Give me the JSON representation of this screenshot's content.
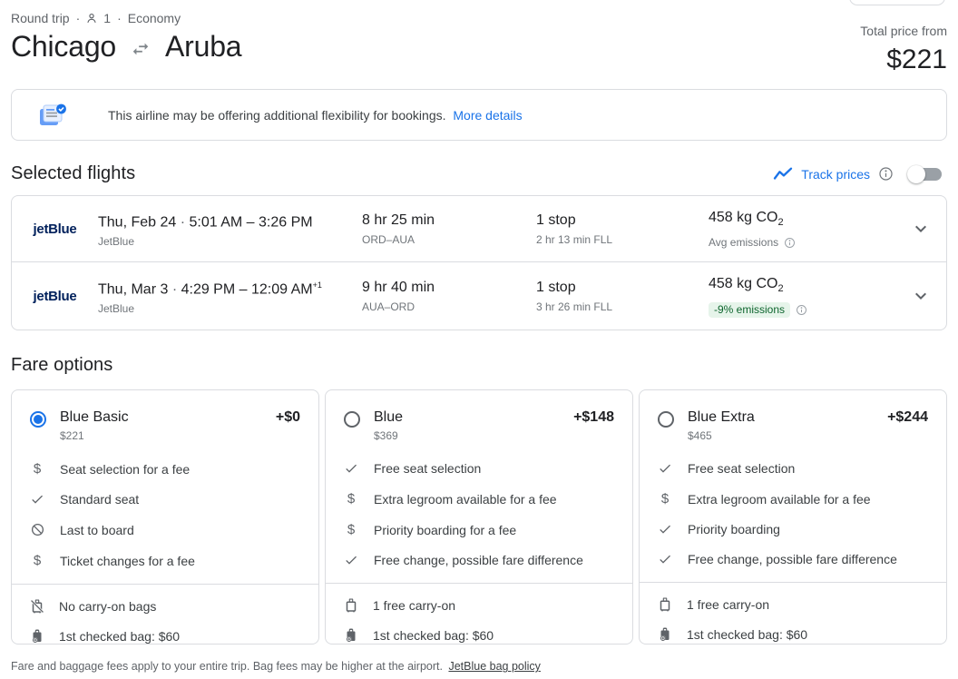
{
  "header": {
    "trip_type": "Round trip",
    "separator": "·",
    "passenger_count": "1",
    "cabin_class": "Economy",
    "origin": "Chicago",
    "destination": "Aruba",
    "total_price_label": "Total price from",
    "total_price": "$221"
  },
  "banner": {
    "message": "This airline may be offering additional flexibility for bookings.",
    "link_label": "More details"
  },
  "selected_flights": {
    "title": "Selected flights",
    "track_prices": {
      "label": "Track prices",
      "enabled": false
    },
    "flights": [
      {
        "airline_logo_text": "jetBlue",
        "date": "Thu, Feb 24",
        "dot": "·",
        "times": "5:01 AM – 3:26 PM",
        "times_superscript": "",
        "airline": "JetBlue",
        "duration": "8 hr 25 min",
        "route": "ORD–AUA",
        "stops": "1 stop",
        "stops_detail": "2 hr 13 min FLL",
        "emissions_prefix": "458 kg CO",
        "emissions_sub": "2",
        "emissions_note": "Avg emissions",
        "emissions_badge": false
      },
      {
        "airline_logo_text": "jetBlue",
        "date": "Thu, Mar 3",
        "dot": "·",
        "times": "4:29 PM – 12:09 AM",
        "times_superscript": "+1",
        "airline": "JetBlue",
        "duration": "9 hr 40 min",
        "route": "AUA–ORD",
        "stops": "1 stop",
        "stops_detail": "3 hr 26 min FLL",
        "emissions_prefix": "458 kg CO",
        "emissions_sub": "2",
        "emissions_note": "-9% emissions",
        "emissions_badge": true
      }
    ]
  },
  "fare_options": {
    "title": "Fare options",
    "cards": [
      {
        "name": "Blue Basic",
        "base_price": "$221",
        "price_delta": "+$0",
        "selected": true,
        "features": [
          {
            "icon": "dollar-icon",
            "text": "Seat selection for a fee"
          },
          {
            "icon": "check-icon",
            "text": "Standard seat"
          },
          {
            "icon": "block-icon",
            "text": "Last to board"
          },
          {
            "icon": "dollar-icon",
            "text": "Ticket changes for a fee"
          }
        ],
        "baggage": [
          {
            "icon": "no-carry-on-bag-icon",
            "text": "No carry-on bags"
          },
          {
            "icon": "checked-bag-icon",
            "text": "1st checked bag: $60"
          }
        ]
      },
      {
        "name": "Blue",
        "base_price": "$369",
        "price_delta": "+$148",
        "selected": false,
        "features": [
          {
            "icon": "check-icon",
            "text": "Free seat selection"
          },
          {
            "icon": "dollar-icon",
            "text": "Extra legroom available for a fee"
          },
          {
            "icon": "dollar-icon",
            "text": "Priority boarding for a fee"
          },
          {
            "icon": "check-icon",
            "text": "Free change, possible fare difference"
          }
        ],
        "baggage": [
          {
            "icon": "carry-on-bag-icon",
            "text": "1 free carry-on"
          },
          {
            "icon": "checked-bag-icon",
            "text": "1st checked bag: $60"
          }
        ]
      },
      {
        "name": "Blue Extra",
        "base_price": "$465",
        "price_delta": "+$244",
        "selected": false,
        "features": [
          {
            "icon": "check-icon",
            "text": "Free seat selection"
          },
          {
            "icon": "dollar-icon",
            "text": "Extra legroom available for a fee"
          },
          {
            "icon": "check-icon",
            "text": "Priority boarding"
          },
          {
            "icon": "check-icon",
            "text": "Free change, possible fare difference"
          }
        ],
        "baggage": [
          {
            "icon": "carry-on-bag-icon",
            "text": "1 free carry-on"
          },
          {
            "icon": "checked-bag-icon",
            "text": "1st checked bag: $60"
          }
        ]
      }
    ]
  },
  "footer": {
    "text": "Fare and baggage fees apply to your entire trip. Bag fees may be higher at the airport.",
    "link": "JetBlue bag policy"
  },
  "colors": {
    "accent_blue": "#1a73e8",
    "jetblue_navy": "#00205b",
    "emissions_badge_bg": "#e6f4ea",
    "emissions_badge_text": "#0d652d",
    "border": "#dadce0",
    "text_primary": "#202124",
    "text_secondary": "#70757a"
  }
}
